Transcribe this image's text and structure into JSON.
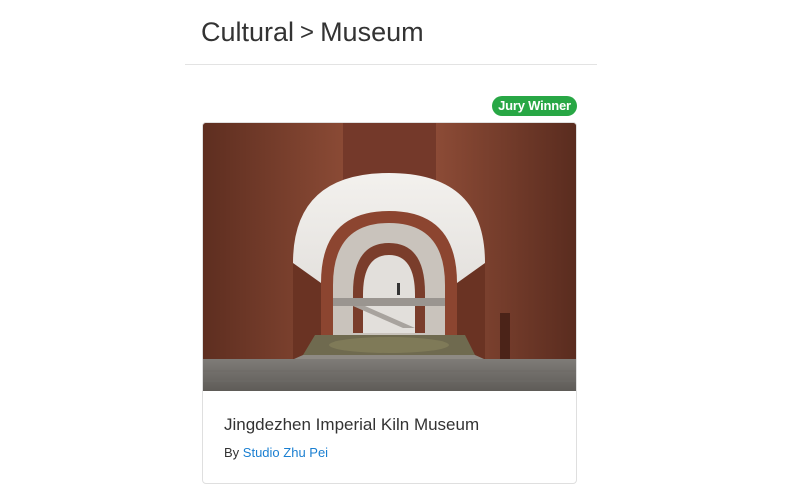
{
  "breadcrumb": {
    "items": [
      "Cultural",
      "Museum"
    ],
    "separator": ">"
  },
  "badge": {
    "label": "Jury Winner",
    "color": "#28a745"
  },
  "project": {
    "title": "Jingdezhen Imperial Kiln Museum",
    "by_prefix": "By",
    "studio": "Studio Zhu Pei",
    "link_color": "#1a7fd1"
  }
}
